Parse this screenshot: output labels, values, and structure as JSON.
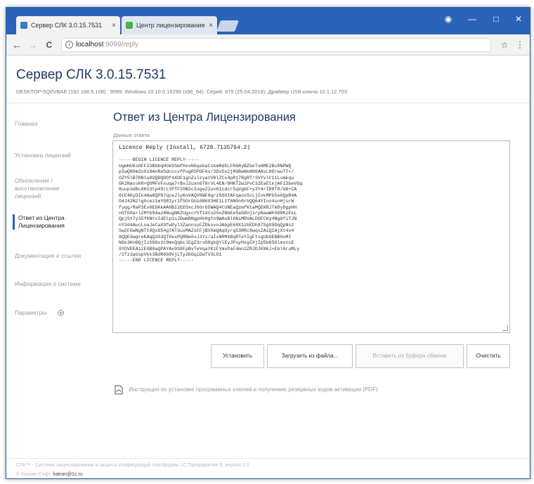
{
  "browser": {
    "tabs": [
      {
        "title": "Сервер СЛК 3.0.15.7531",
        "close": "×"
      },
      {
        "title": "Центр лицензирования",
        "close": "×"
      }
    ],
    "address_host": "localhost",
    "address_rest": ":9099/reply",
    "back_glyph": "←",
    "forward_glyph": "→",
    "reload_glyph": "C",
    "star_glyph": "☆",
    "menu_glyph": "⋮",
    "window_buttons": {
      "account": "◉",
      "minimize": "—",
      "maximize": "□",
      "close": "✕"
    },
    "colors": {
      "titlebar": "#2b63b8",
      "accent": "#1f3864"
    }
  },
  "header": {
    "title": "Сервер СЛК 3.0.15.7531",
    "info": "DESKTOP-5Q0VBAE (192.168.5.108) : 9099.   Windows 10 10.0.16299 (x86_64).   Серий: 875 (25.04.2018).   Драйвер USB ключа 10.1.12.703"
  },
  "sidebar": {
    "items": [
      {
        "label": "Главная"
      },
      {
        "label": "Установка лицензий"
      },
      {
        "label": "Обновление / восстановление лицензий"
      },
      {
        "label": "Ответ из Центра Лицензирования"
      },
      {
        "label": "Документация и ссылки"
      },
      {
        "label": "Информация о системе"
      },
      {
        "label": "Параметры"
      }
    ]
  },
  "main": {
    "title": "Ответ из Центра Лицензирования",
    "field_label": "Данные ответа",
    "reply_header": "Licence Reply (Install, 6728.7135764.2)",
    "reply_lines": [
      "-----BEGIN LICENCE REPLY-----",
      "UgmHU6sHFF23BGbqHOkGSmfHxvNGqebaCskmMd5LFR6RyBZbkTxHME2BcRNPWQ",
      "pIwQ88m2oX18AnRe5dcccvfPugRSPDF6s/3Ds5x2jRGBeNkN96ANsLHGrwuTT+/",
      "OZY5lB7RBlu8OQDQDOf4XDF1gnZslzyaYVRlZCs4pRj7RgRT/3VYvlC11Lsmkqu",
      "GK2NaosKR+QOMFVFxuqa7rBvJ2uxn6T8rVL4EN/8HKT2wiPvC32EaEtkjAF13beVGq",
      "8uup3dBcXH13tp4SrLYPTFI0B2cIoge22uv61cdcr5qVgbF+y3Y4rIR8T9/G8+CA",
      "8tE4KyDIk46w8QP87qceJlyKoVAQV8WF8qrz5OUIAFqaoxScLjIvkMPb5e6QpR4A",
      "O4J42N2lghcez1mYGRIyr1f5OrGUi6N0X3HE1L1f8N0n8rbQQ64YIno4snHjsrW",
      "fyqg/RaP3Ex0EGKkAA0BI2EEOxcJGOrG5WAQ4tUNEaQzmfKtaMQDXRJTm9yDgpHH",
      "nGTG9arl2MYb94az8NugNKZUgxcrhf1Xto2SnZNbEe5aG8Uj1rpNawWh5D8KzEkL",
      "QpjSt7y35fKNtvIdEtp1sJDwm8NgpHkHgtn9WAvBl6NiMRVALDGFCKy4Ng6fiTJN",
      "nY3d4AucLoaJeCaX9fwPyl3ZaonsuFZDkovoJAbpE68X1zbEDh87SgU9DqQpNsz",
      "Sw2FGwNgNTt9Qx654gTAT3uxMAZsCFjBVXmQAqUyrqS3RRc8wqxZA1Q1AjXt4v4",
      "8QQE9wgreKAqQ2O3QT0vxPQRNe6vJ3Ys/aIxNRMXBqRTeYIgFtsgUbUEBB0uMI",
      "N6k3KnBQjIzS8Gvzc9mvQqbclEgZ3rvG8gkQYlEyJPuyHxgIXjIp5b65OlmxnsE",
      "8YDVEEA1iEGB0aQPAYAx9S8FpBvTeVqaYKzFYmvPaF4mn2ZRJDJRXKJ+Ebl6ruMLy",
      "/2Tz3aUspVkk3BdR6G9VjLTy2KGqiDwTV3LO1",
      "-----END LICENCE REPLY-----"
    ],
    "buttons": {
      "install": "Установить",
      "load_file": "Загрузить из файла...",
      "paste_clipboard": "Вставить из буфера обмена",
      "clear": "Очистить"
    },
    "pdf_link": "Инструкция по установке программных ключей и получению резервных кодов активации (PDF)"
  },
  "footer": {
    "line1": "СЛК™ - Система лицензирования и защиты конфигураций платформы 1С:Предприятие 8, версия 3.0",
    "line2_prefix": "© Катран Софт, ",
    "email": "katran@1c.ru"
  }
}
